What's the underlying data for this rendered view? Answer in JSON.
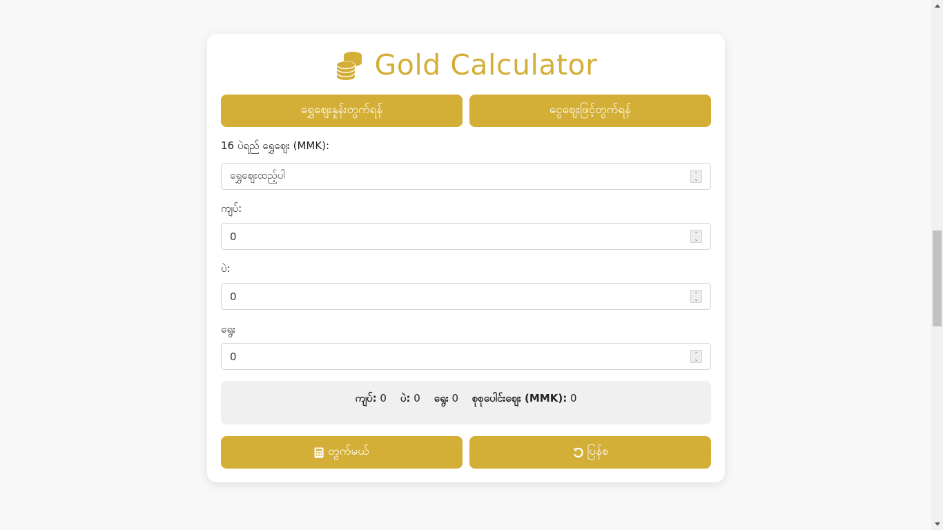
{
  "header": {
    "title": "Gold Calculator",
    "icon": "coins-icon"
  },
  "mode_tabs": {
    "gold_price_tab": "ရွှေဈေးနှုန်းတွက်ရန်",
    "money_price_tab": "ငွေဈေးဖြင့်တွက်ရန်"
  },
  "form": {
    "price_label": "16 ပဲရည် ရွှေဈေး (MMK):",
    "price_placeholder": "ရွှေဈေးထည့်ပါ",
    "kyat_label": "ကျပ်:",
    "kyat_value": "0",
    "pe_label": "ပဲ:",
    "pe_value": "0",
    "yway_label": "ရွေး",
    "yway_value": "0"
  },
  "result": {
    "kyat_label": "ကျပ်:",
    "kyat_value": "0",
    "pe_label": "ပဲ:",
    "pe_value": "0",
    "yway_label": "ရွေး",
    "yway_value": "0",
    "total_label": "စုစုပေါင်းဈေး (MMK):",
    "total_value": "0"
  },
  "actions": {
    "calculate_label": "တွက်မယ်",
    "calculate_icon": "calculator-icon",
    "reset_label": "ပြန်စ",
    "reset_icon": "undo-icon"
  },
  "colors": {
    "accent": "#d4af37",
    "background": "#f8f8f8",
    "card": "#ffffff",
    "result_bg": "#f0f0f0"
  }
}
